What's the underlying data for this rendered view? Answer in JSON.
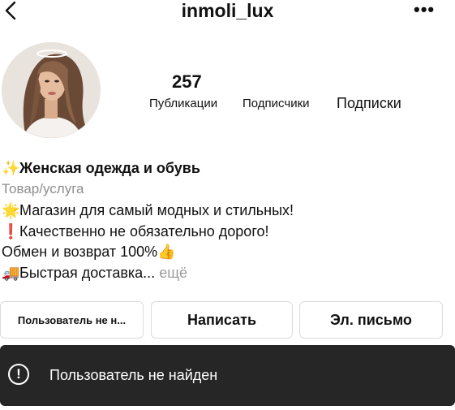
{
  "header": {
    "username": "inmoli_lux",
    "back_icon": "chevron-left-icon",
    "more_icon": "ellipsis-icon",
    "more_glyph": "•••"
  },
  "profile": {
    "avatar_icon": "profile-photo",
    "posts_count": "257",
    "posts_label": "Публикации",
    "followers_label": "Подписчики",
    "following_label": "Подписки"
  },
  "bio": {
    "name_emoji": "✨",
    "name": "Женская одежда и обувь",
    "category": "Товар/услуга",
    "lines": [
      {
        "emoji": "🌟",
        "text": "Магазин для самый модных и стильных!"
      },
      {
        "emoji": "❗",
        "text": "Качественно не обязательно дорого!"
      },
      {
        "emoji": "👍",
        "text": "Обмен и возврат 100%"
      },
      {
        "emoji": "🚚",
        "text": "Быстрая доставка..."
      }
    ],
    "more_link": "ещё"
  },
  "buttons": {
    "user_label": "Пользователь не н...",
    "message_label": "Написать",
    "email_label": "Эл. письмо"
  },
  "toast": {
    "icon": "alert-circle-icon",
    "icon_glyph": "!",
    "text": "Пользователь не найден"
  },
  "colors": {
    "toast_bg": "#262626",
    "muted_text": "#8e8e8e",
    "button_border": "#dbdbdb"
  }
}
